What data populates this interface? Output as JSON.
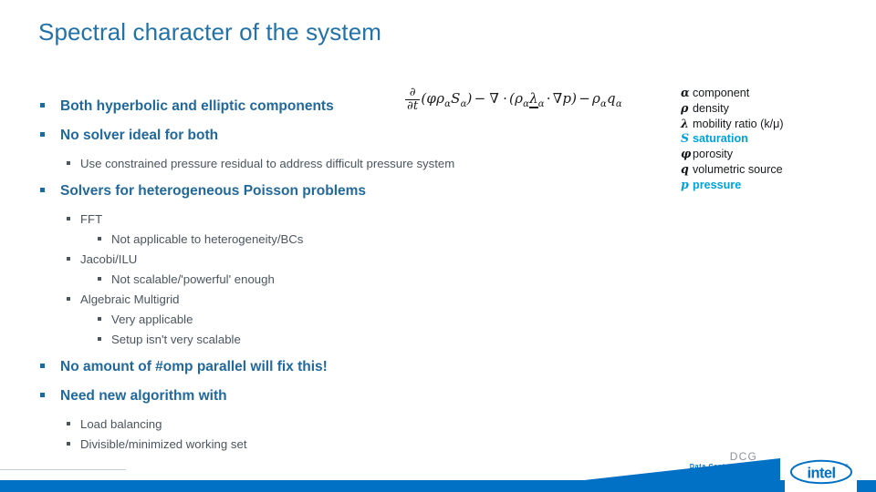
{
  "slide": {
    "title": "Spectral character of the system"
  },
  "bullets": [
    {
      "level": 1,
      "text": "Both hyperbolic and elliptic components"
    },
    {
      "level": 1,
      "text": "No solver ideal for both"
    },
    {
      "level": 2,
      "text": "Use constrained pressure residual to address difficult pressure system"
    },
    {
      "level": 1,
      "text": "Solvers for heterogeneous Poisson problems"
    },
    {
      "level": 2,
      "text": "FFT"
    },
    {
      "level": 3,
      "text": "Not applicable to heterogeneity/BCs"
    },
    {
      "level": 2,
      "text": "Jacobi/ILU"
    },
    {
      "level": 3,
      "text": "Not scalable/'powerful' enough"
    },
    {
      "level": 2,
      "text": "Algebraic Multigrid"
    },
    {
      "level": 3,
      "text": "Very applicable"
    },
    {
      "level": 3,
      "text": "Setup isn't very scalable"
    },
    {
      "level": 1,
      "text": "No amount of #omp parallel will fix this!"
    },
    {
      "level": 1,
      "text": "Need new algorithm with"
    },
    {
      "level": 2,
      "text": "Load balancing"
    },
    {
      "level": 2,
      "text": "Divisible/minimized working set"
    }
  ],
  "equation": {
    "plain_text": "∂/∂t(φραSα) − ∇ · (ρα λα · ∇p) − ραqα",
    "d_numerator": "∂",
    "d_denominator": "∂t",
    "term1": "(φρ",
    "sub_alpha": "α",
    "term1b": "S",
    "term1c": ")",
    "minus": "−",
    "nabla": "∇",
    "dot": "·",
    "open_paren": "(ρ",
    "lambda": "λ",
    "grad_p": "∇p)",
    "rho": "ρ",
    "q": "q"
  },
  "legend": {
    "entries": [
      {
        "symbol": "α",
        "label": "component",
        "accent": false
      },
      {
        "symbol": "ρ",
        "label": "density",
        "accent": false
      },
      {
        "symbol": "λ",
        "label": "mobility ratio (k/μ)",
        "accent": false
      },
      {
        "symbol": "S",
        "label": "saturation",
        "accent": true
      },
      {
        "symbol": "φ",
        "label": "porosity",
        "accent": false
      },
      {
        "symbol": "q",
        "label": "volumetric source",
        "accent": false
      },
      {
        "symbol": "p",
        "label": "pressure",
        "accent": true
      }
    ]
  },
  "footer": {
    "dcg_title": "DCG",
    "dcg_subtitle": "Data Center Group",
    "logo_text": "intel",
    "logo_mark": "®"
  },
  "colors": {
    "title_blue": "#2172a8",
    "level1_blue": "#21699c",
    "level2_slate": "#4a555e",
    "accent_cyan": "#00a2dd",
    "intel_blue": "#0071c5"
  }
}
